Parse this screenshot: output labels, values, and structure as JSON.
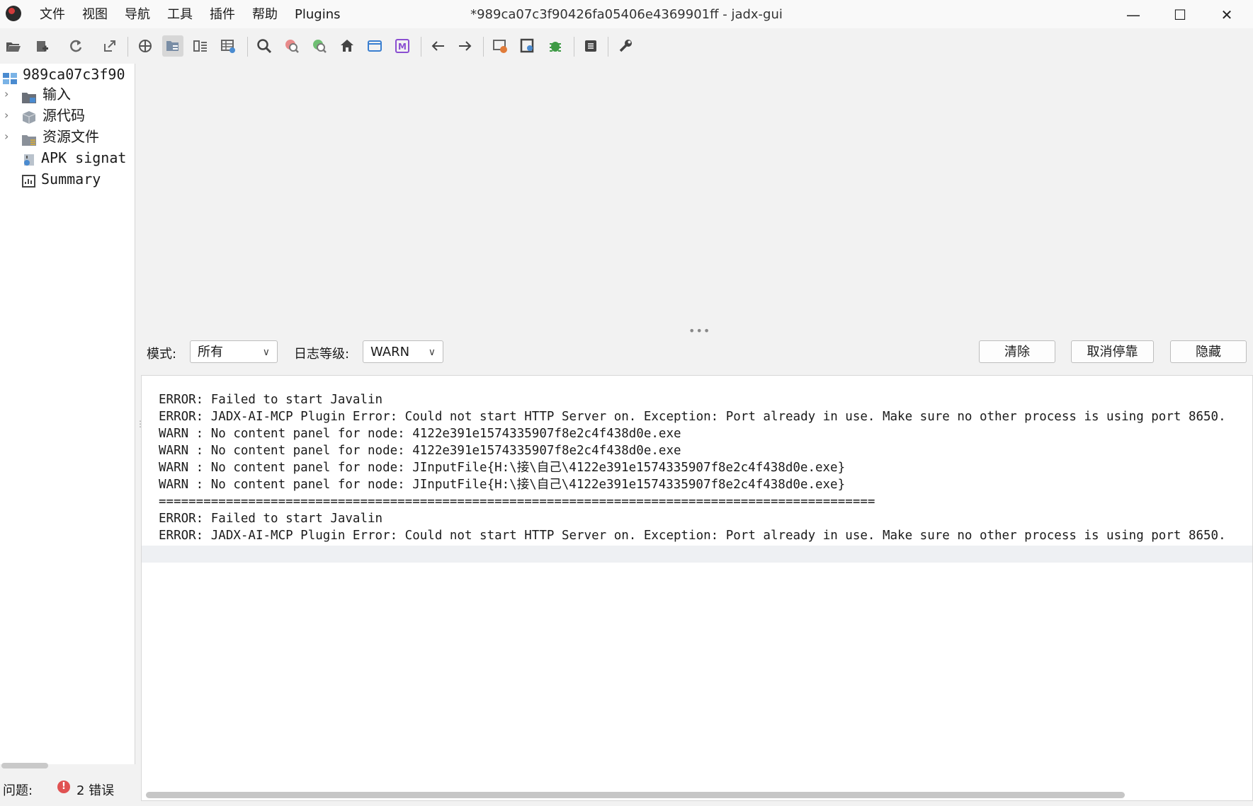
{
  "window": {
    "title": "*989ca07c3f90426fa05406e4369901ff - jadx-gui",
    "controls": [
      "—",
      "☐",
      "✕"
    ]
  },
  "menu": [
    "文件",
    "视图",
    "导航",
    "工具",
    "插件",
    "帮助",
    "Plugins"
  ],
  "toolbar_icons": [
    "open-file-icon",
    "add-files-icon",
    "reload-icon",
    "export-icon",
    "sync-icon",
    "flatten-packages-icon",
    "code-view-icon",
    "table-icon",
    "search-icon",
    "search-class-icon",
    "search-usage-icon",
    "home-icon",
    "window-icon",
    "m-icon",
    "back-icon",
    "forward-icon",
    "decompile-settings-icon",
    "quick-search-icon",
    "debug-icon",
    "log-icon",
    "preferences-icon"
  ],
  "tree": {
    "root": "989ca07c3f90",
    "items": [
      {
        "label": "输入",
        "icon": "folder-icon"
      },
      {
        "label": "源代码",
        "icon": "package-icon"
      },
      {
        "label": "资源文件",
        "icon": "resources-icon"
      },
      {
        "label": "APK signat",
        "icon": "certificate-icon"
      },
      {
        "label": "Summary",
        "icon": "summary-icon"
      }
    ]
  },
  "status": {
    "label": "问题:",
    "error_count": "2 错误"
  },
  "log_panel": {
    "mode_label": "模式:",
    "mode_value": "所有",
    "level_label": "日志等级:",
    "level_value": "WARN",
    "buttons": {
      "clear": "清除",
      "undock": "取消停靠",
      "hide": "隐藏"
    },
    "lines": [
      "ERROR: Failed to start Javalin",
      "ERROR: JADX-AI-MCP Plugin Error: Could not start HTTP Server on. Exception: Port already in use. Make sure no other process is using port 8650.",
      "WARN : No content panel for node: 4122e391e1574335907f8e2c4f438d0e.exe",
      "WARN : No content panel for node: 4122e391e1574335907f8e2c4f438d0e.exe",
      "WARN : No content panel for node: JInputFile{H:\\接\\自己\\4122e391e1574335907f8e2c4f438d0e.exe}",
      "WARN : No content panel for node: JInputFile{H:\\接\\自己\\4122e391e1574335907f8e2c4f438d0e.exe}",
      "================================================================================================",
      "ERROR: Failed to start Javalin",
      "ERROR: JADX-AI-MCP Plugin Error: Could not start HTTP Server on. Exception: Port already in use. Make sure no other process is using port 8650."
    ]
  },
  "colors": {
    "error_badge": "#e05252",
    "background": "#f2f2f2",
    "panel": "#ffffff"
  }
}
